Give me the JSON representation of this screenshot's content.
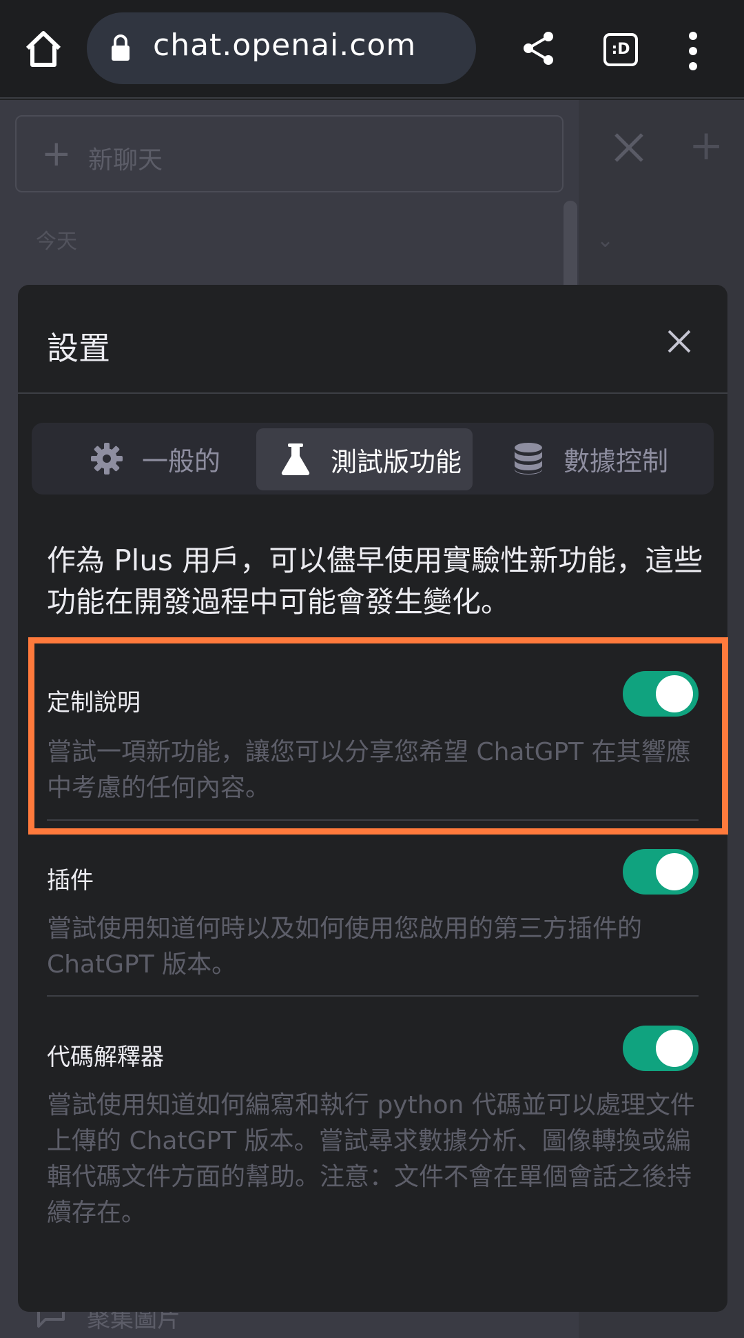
{
  "browser": {
    "url": "chat.openai.com",
    "tabs_label": ":D"
  },
  "background": {
    "new_chat_label": "新聊天",
    "today_label": "今天",
    "bottom_label": "聚集圖片"
  },
  "modal": {
    "title": "設置",
    "tabs": [
      {
        "label": "一般的",
        "icon": "gear-icon",
        "active": false
      },
      {
        "label": "測試版功能",
        "icon": "flask-icon",
        "active": true
      },
      {
        "label": "數據控制",
        "icon": "database-icon",
        "active": false
      }
    ],
    "intro": "作為 Plus 用戶，可以儘早使用實驗性新功能，這些功能在開發過程中可能會發生變化。",
    "features": [
      {
        "title": "定制說明",
        "description": "嘗試一項新功能，讓您可以分享您希望 ChatGPT 在其響應中考慮的任何內容。",
        "enabled": true
      },
      {
        "title": "插件",
        "description": "嘗試使用知道何時以及如何使用您啟用的第三方插件的 ChatGPT 版本。",
        "enabled": true
      },
      {
        "title": "代碼解釋器",
        "description": "嘗試使用知道如何編寫和執行 python 代碼並可以處理文件上傳的 ChatGPT 版本。嘗試尋求數據分析、圖像轉換或編輯代碼文件方面的幫助。注意：文件不會在單個會話之後持續存在。",
        "enabled": true
      }
    ]
  },
  "colors": {
    "accent_toggle": "#10a37f",
    "highlight_box": "#ff7a3c",
    "modal_bg": "#202123"
  }
}
